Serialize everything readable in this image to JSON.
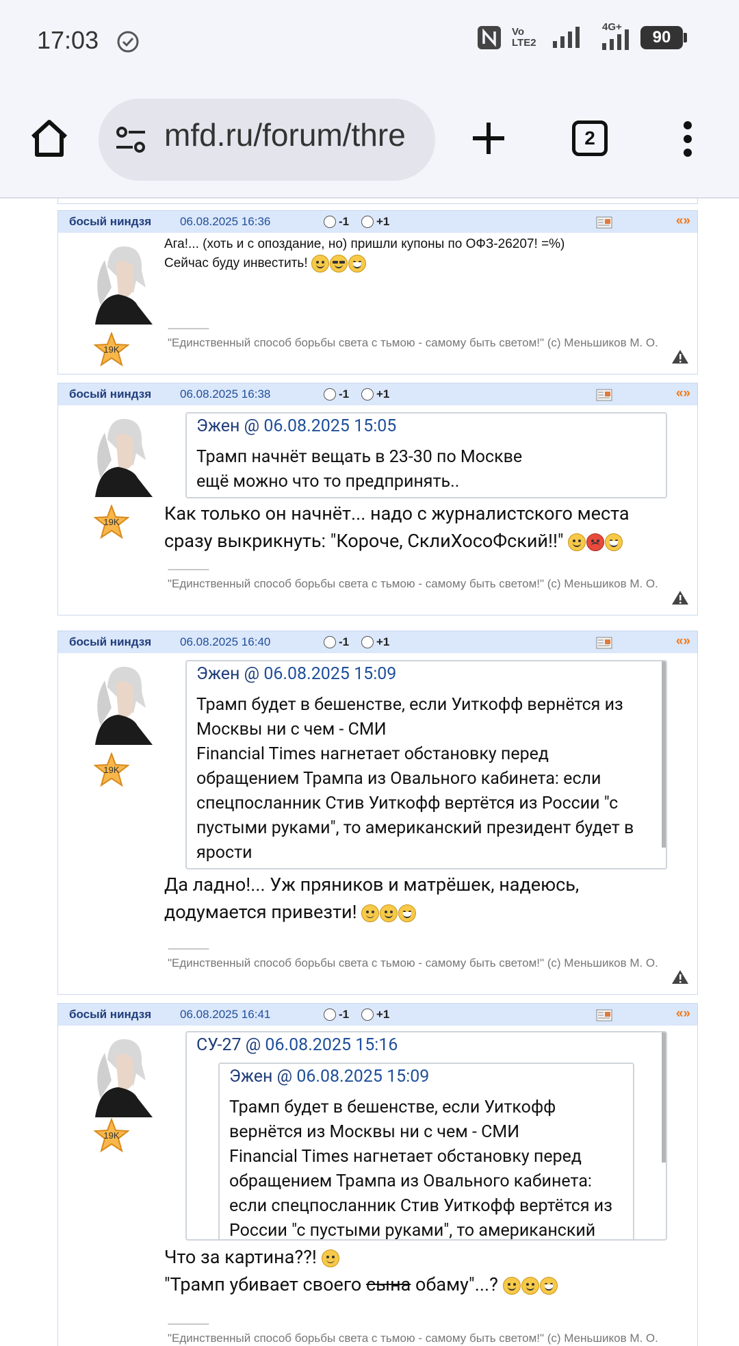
{
  "status_bar": {
    "time": "17:03",
    "volte": "Vo LTE2",
    "network": "4G+",
    "battery": "90"
  },
  "browser": {
    "url": "mfd.ru/forum/thre",
    "tab_count": "2"
  },
  "signature_sep": "--------------------",
  "signature": "\"Единственный способ борьбы света с тьмою - самому быть светом!\" (с) Меньшиков М. О.",
  "star_label": "19K",
  "quote_icon": "«»",
  "vote_minus": "-1",
  "vote_plus": "+1",
  "posts": [
    {
      "author": "босый ниндзя",
      "date": "06.08.2025 16:36",
      "lines": [
        "Ага!... (хоть и с опоздание, но) пришли купоны по ОФЗ-26207! =%)",
        "Сейчас буду инвестить!"
      ]
    },
    {
      "author": "босый ниндзя",
      "date": "06.08.2025 16:38",
      "quote": {
        "author": "Эжен",
        "at": "@",
        "date": "06.08.2025 15:05",
        "lines": [
          "Трамп начнёт вещать в 23-30 по Москве",
          "ещё можно что то предпринять.."
        ]
      },
      "lines": [
        "Как только он начнёт... надо с журналистского места",
        "сразу выкрикнуть: \"Короче, СклиХосоФский!!\""
      ]
    },
    {
      "author": "босый ниндзя",
      "date": "06.08.2025 16:40",
      "quote": {
        "author": "Эжен",
        "at": "@",
        "date": "06.08.2025 15:09",
        "lines": [
          "Трамп будет в бешенстве, если Уиткофф вернётся из",
          "Москвы ни с чем - СМИ",
          "Financial Times нагнетает обстановку перед",
          "обращением Трампа из Овального кабинета: если",
          "спецпосланник Стив Уиткофф вертётся из России \"с",
          "пустыми руками\", то американский президент будет в",
          "ярости"
        ]
      },
      "lines": [
        "Да ладно!... Уж пряников и матрёшек, надеюсь,",
        "додумается привезти!"
      ]
    },
    {
      "author": "босый ниндзя",
      "date": "06.08.2025 16:41",
      "quote": {
        "author": "СУ-27",
        "at": "@",
        "date": "06.08.2025 15:16",
        "inner": {
          "author": "Эжен",
          "at": "@",
          "date": "06.08.2025 15:09",
          "lines": [
            "Трамп будет в бешенстве, если Уиткофф",
            "вернётся из Москвы ни с чем - СМИ",
            "Financial Times нагнетает обстановку перед",
            "обращением Трампа из Овального кабинета:",
            "если спецпосланник Стив Уиткофф вертётся из",
            "России \"с пустыми руками\", то американский"
          ]
        }
      },
      "line1": "Что за картина??!",
      "line2_pre": "\"Трамп убивает своего ",
      "line2_strike": "сына",
      "line2_post": " обаму\"...?"
    }
  ]
}
